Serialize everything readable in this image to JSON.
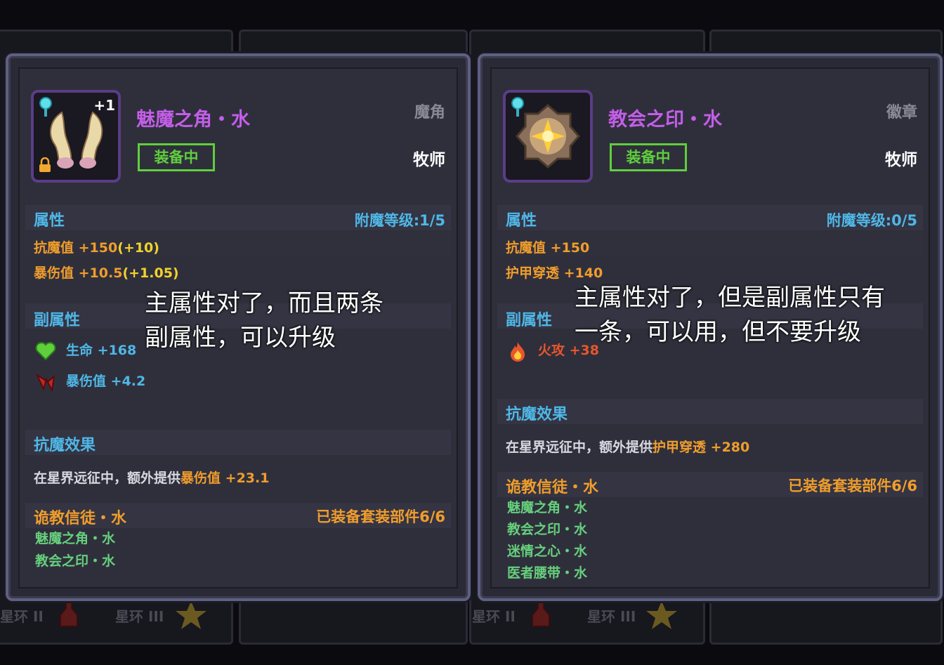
{
  "cards": [
    {
      "name": "魅魔之角・水",
      "type": "魔角",
      "equip_label": "装备中",
      "class": "牧师",
      "plus_level": "+1",
      "attr_title": "属性",
      "enchant": "附魔等级:1/5",
      "stats": [
        {
          "label": "抗魔值",
          "value": "+150",
          "bonus": "(+10)"
        },
        {
          "label": "暴伤值",
          "value": "+10.5",
          "bonus": "(+1.05)"
        }
      ],
      "sub_title": "副属性",
      "substats": [
        {
          "label": "生命",
          "value": "+168",
          "color": "#4fb7e6",
          "icon": "heart-icon"
        },
        {
          "label": "暴伤值",
          "value": "+4.2",
          "color": "#4fb7e6",
          "icon": "crit-damage-icon"
        }
      ],
      "effect_title": "抗魔效果",
      "effect_prefix": "在星界远征中，额外提供",
      "effect_highlight": "暴伤值",
      "effect_value": "+23.1",
      "set_name": "诡教信徒・水",
      "set_count": "已装备套装部件6/6",
      "set_items": [
        "魅魔之角・水",
        "教会之印・水"
      ],
      "overlay": "主属性对了，而且两条\n副属性，可以升级"
    },
    {
      "name": "教会之印・水",
      "type": "徽章",
      "equip_label": "装备中",
      "class": "牧师",
      "attr_title": "属性",
      "enchant": "附魔等级:0/5",
      "stats": [
        {
          "label": "抗魔值",
          "value": "+150"
        },
        {
          "label": "护甲穿透",
          "value": "+140"
        }
      ],
      "sub_title": "副属性",
      "substats": [
        {
          "label": "火攻",
          "value": "+38",
          "color": "#e8562c",
          "icon": "fire-icon"
        }
      ],
      "effect_title": "抗魔效果",
      "effect_prefix": "在星界远征中，额外提供",
      "effect_highlight": "护甲穿透",
      "effect_value": "+280",
      "set_name": "诡教信徒・水",
      "set_count": "已装备套装部件6/6",
      "set_items": [
        "魅魔之角・水",
        "教会之印・水",
        "迷情之心・水",
        "医者腰带・水"
      ],
      "overlay": "主属性对了，但是副属性只有\n一条，可以用，但不要升级"
    }
  ],
  "bottom_strip": {
    "labels": [
      "星环 II",
      "星环 III",
      "星环 II",
      "星环 III"
    ]
  },
  "colors": {
    "name": "#c35ee8",
    "equip": "#5fcf3c",
    "section": "#4fb7e6",
    "orange": "#f09d2c",
    "set_item": "#66d07c"
  }
}
